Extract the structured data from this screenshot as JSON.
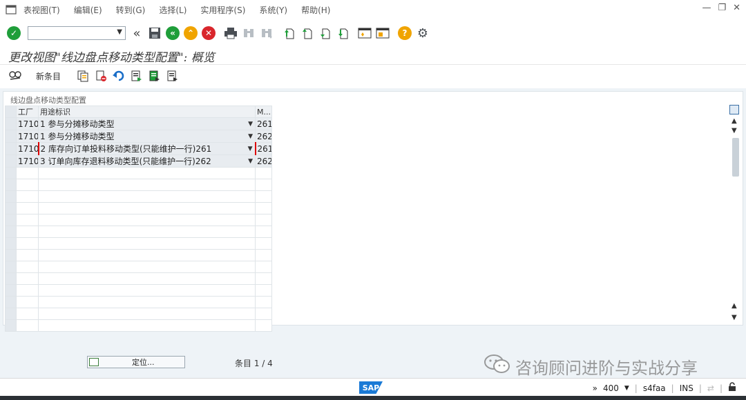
{
  "menu": {
    "items": [
      "表视图(T)",
      "编辑(E)",
      "转到(G)",
      "选择(L)",
      "实用程序(S)",
      "系统(Y)",
      "帮助(H)"
    ]
  },
  "window_controls": {
    "minimize": "—",
    "restore": "❐",
    "close": "✕"
  },
  "toolbar": {
    "command_field_value": "",
    "buttons": [
      "enter",
      "save",
      "back",
      "exit",
      "cancel",
      "print",
      "find",
      "find-next",
      "first-page",
      "previous-page",
      "next-page",
      "last-page",
      "create-session",
      "shortcut",
      "help",
      "customize"
    ]
  },
  "title": "更改视图\"线边盘点移动类型配置\": 概览",
  "app_toolbar": {
    "new_entries_label": "新条目"
  },
  "panel": {
    "title": "线边盘点移动类型配置",
    "columns": [
      "工厂",
      "用途标识",
      "M..."
    ],
    "rows": [
      {
        "plant": "1710",
        "usage": "1 参与分摊移动类型",
        "mvt": "261"
      },
      {
        "plant": "1710",
        "usage": "1 参与分摊移动类型",
        "mvt": "262"
      },
      {
        "plant": "1710",
        "usage": "2 库存向订单投料移动类型(只能维护一行)261",
        "mvt": "261"
      },
      {
        "plant": "1710",
        "usage": "3 订单向库存退料移动类型(只能维护一行)262",
        "mvt": "262"
      }
    ]
  },
  "footer": {
    "position_button": "定位...",
    "entry_label": "条目",
    "entry_value": "1 / 4"
  },
  "watermark": "咨询顾问进阶与实战分享",
  "status": {
    "logo": "SAP",
    "client": "400",
    "system": "s4faa",
    "mode": "INS"
  }
}
